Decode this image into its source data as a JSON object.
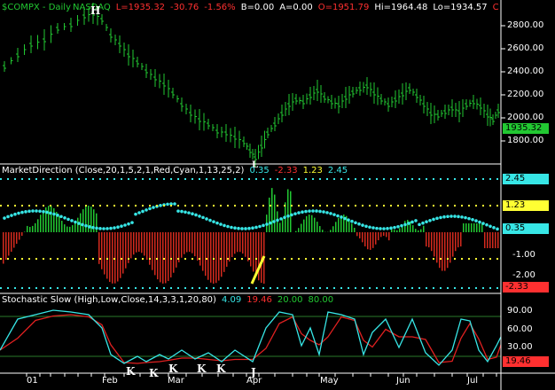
{
  "header": {
    "symbol": "$COMPX - Daily",
    "exchange": "NASDAQ",
    "last": "L=1935.32",
    "change": "-30.76",
    "change_pct": "-1.56%",
    "b": "B=0.00",
    "a": "A=0.00",
    "open": "O=1951.79",
    "high": "Hi=1964.48",
    "low": "Lo=1934.57",
    "c": "C"
  },
  "price_panel": {
    "y_ticks": [
      "2800.00",
      "2600.00",
      "2400.00",
      "2200.00",
      "2000.00",
      "1800.00"
    ],
    "last_tag": "1935.32",
    "marker_h": "H",
    "marker_l": "L"
  },
  "market_direction": {
    "label": "MarketDirection  (Close,20,1,5,2,1,Red,Cyan,1,13,25,2)",
    "v1": "0.35",
    "v2": "-2.33",
    "v3": "1.23",
    "v4": "2.45",
    "tags": {
      "top": "2.45",
      "mid": "1.23",
      "cur": "0.35",
      "low": "-2.33"
    },
    "y_ticks": [
      "-1.00",
      "-2.00"
    ]
  },
  "stochastic": {
    "label": "Stochastic Slow  (High,Low,Close,14,3,3,1,20,80)",
    "v1": "4.09",
    "v2": "19.46",
    "v3": "20.00",
    "v4": "80.00",
    "y_ticks": [
      "90.00",
      "60.00",
      "30.00"
    ],
    "tag": "19.46",
    "k_marks": [
      "K",
      "K",
      "K",
      "K",
      "K"
    ],
    "j_mark": "J"
  },
  "x_axis": [
    "01",
    "Feb",
    "Mar",
    "Apr",
    "May",
    "Jun",
    "Jul"
  ],
  "colors": {
    "price": "#22c832",
    "up_bar": "#22c832",
    "down_bar": "#d42a1e",
    "cyan": "#37e6e6",
    "yellow": "#ffff33",
    "red": "#ff3030",
    "stoch_k": "#37e6e6",
    "stoch_d": "#e02020"
  }
}
